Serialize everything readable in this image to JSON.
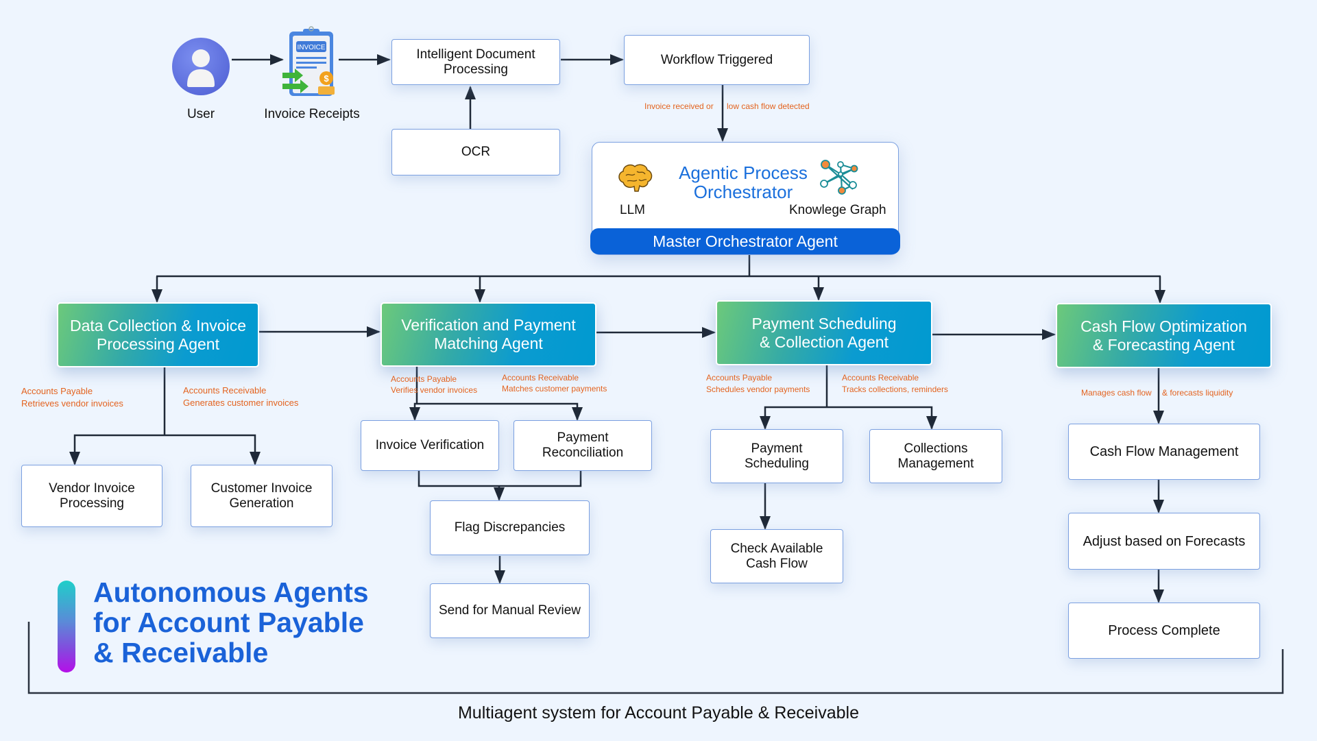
{
  "title": {
    "main": "Autonomous Agents\nfor Account Payable\n& Receivable",
    "caption": "Multiagent system for Account Payable & Receivable",
    "accent_color": "#1a62d8"
  },
  "inputs": {
    "user_label": "User",
    "invoice_label": "Invoice Receipts",
    "invoice_badge": "INVOICE"
  },
  "top_flow": {
    "idp": "Intelligent Document\nProcessing",
    "ocr": "OCR",
    "workflow": "Workflow Triggered",
    "trigger_note_left": "Invoice received or",
    "trigger_note_right": "low cash flow detected"
  },
  "orchestrator": {
    "title": "Agentic Process\nOrchestrator",
    "llm_label": "LLM",
    "kg_label": "Knowlege Graph",
    "bar_label": "Master Orchestrator Agent",
    "bar_color": "#0a62d8"
  },
  "agents": [
    {
      "name": "Data Collection & Invoice\nProcessing Agent",
      "note_left": "Accounts Payable\nRetrieves vendor invoices",
      "note_right": "Accounts Receivable\nGenerates customer invoices",
      "children": [
        "Vendor Invoice\nProcessing",
        "Customer Invoice\nGeneration"
      ]
    },
    {
      "name": "Verification and Payment\nMatching Agent",
      "note_left": "Accounts Payable\nVerifies vendor invoices",
      "note_right": "Accounts Receivable\nMatches customer payments",
      "children": [
        "Invoice Verification",
        "Payment\nReconciliation"
      ],
      "followups": [
        "Flag Discrepancies",
        "Send for Manual Review"
      ]
    },
    {
      "name": "Payment Scheduling\n& Collection Agent",
      "note_left": "Accounts Payable\nSchedules vendor payments",
      "note_right": "Accounts Receivable\nTracks collections, reminders",
      "children": [
        "Payment\nScheduling",
        "Collections\nManagement"
      ],
      "followups": [
        "Check Available\nCash Flow"
      ]
    },
    {
      "name": "Cash Flow Optimization\n& Forecasting Agent",
      "note_left": "Manages cash flow",
      "note_right": "& forecasts liquidity",
      "children": [
        "Cash Flow Management",
        "Adjust based on Forecasts",
        "Process Complete"
      ]
    }
  ],
  "colors": {
    "background": "#eef5fe",
    "annotation": "#e3631f",
    "connector": "#1f2937"
  }
}
